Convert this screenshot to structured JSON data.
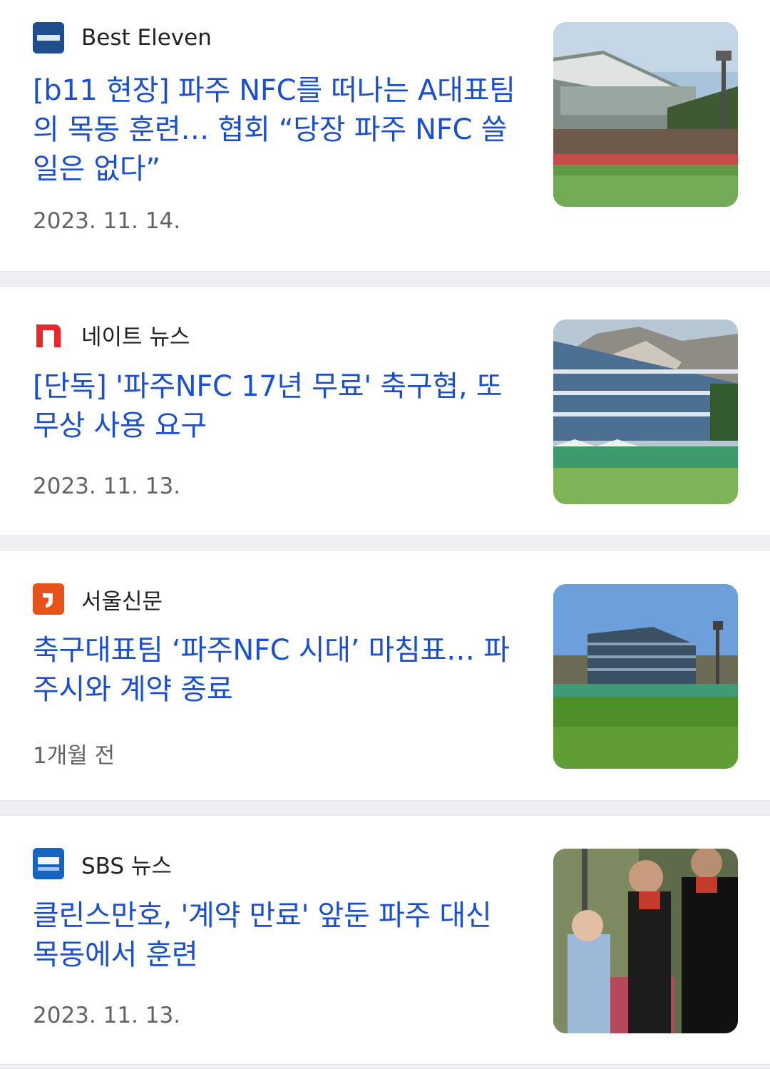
{
  "articles": [
    {
      "source": "Best Eleven",
      "logo_icon": "best-eleven-logo",
      "logo_color": "#1f4e8c",
      "headline": "[b11 현장] 파주 NFC를 떠나는 A대표팀의 목동 훈련… 협회 “당장 파주 NFC 쓸 일은 없다”",
      "date": "2023. 11. 14.",
      "thumbnail": "stadium-stands-photo"
    },
    {
      "source": "네이트 뉴스",
      "logo_icon": "nate-logo",
      "logo_color": "#e8262b",
      "headline": "[단독] '파주NFC 17년 무료' 축구협, 또 무상 사용 요구",
      "date": "2023. 11. 13.",
      "thumbnail": "training-center-building-photo"
    },
    {
      "source": "서울신문",
      "logo_icon": "seoul-shinmun-logo",
      "logo_color": "#e8531c",
      "headline": "축구대표팀 ‘파주NFC 시대’ 마침표… 파주시와 계약 종료",
      "date": "1개월 전",
      "thumbnail": "training-ground-photo"
    },
    {
      "source": "SBS 뉴스",
      "logo_icon": "sbs-news-logo",
      "logo_color": "#1565c0",
      "headline": "클린스만호, '계약 만료' 앞둔 파주 대신 목동에서 훈련",
      "date": "2023. 11. 13.",
      "thumbnail": "team-training-photo"
    }
  ]
}
